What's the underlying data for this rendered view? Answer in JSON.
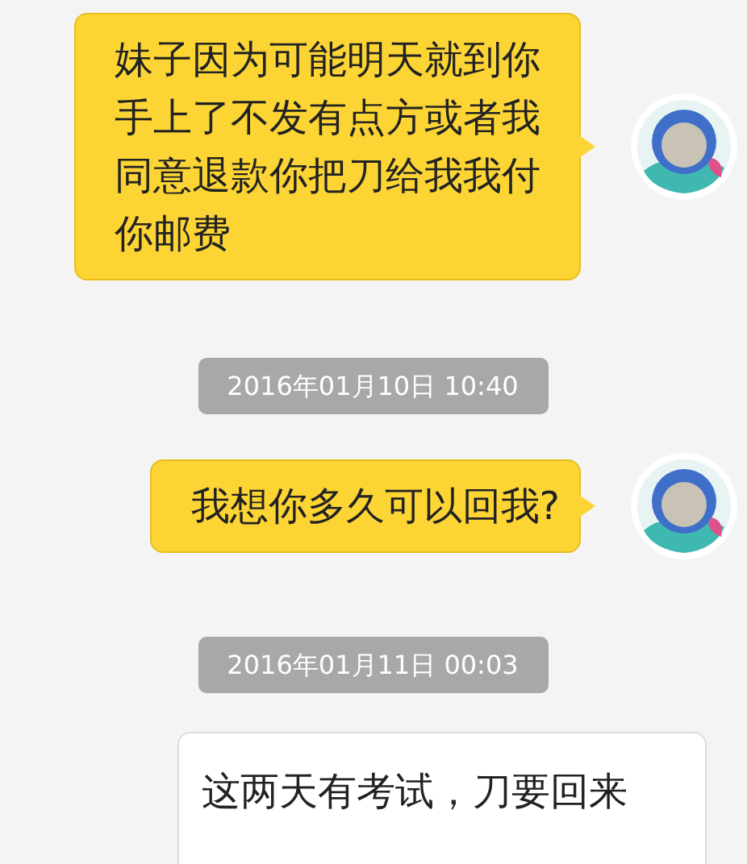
{
  "messages": [
    {
      "kind": "outgoing",
      "text": "妹子因为可能明天就到你手上了不发有点方或者我同意退款你把刀给我我付你邮费"
    },
    {
      "kind": "timestamp",
      "text": "2016年01月10日 10:40"
    },
    {
      "kind": "outgoing",
      "text": "我想你多久可以回我?"
    },
    {
      "kind": "timestamp",
      "text": "2016年01月11日 00:03"
    },
    {
      "kind": "incoming",
      "text": "这两天有考试，刀要回来"
    }
  ]
}
